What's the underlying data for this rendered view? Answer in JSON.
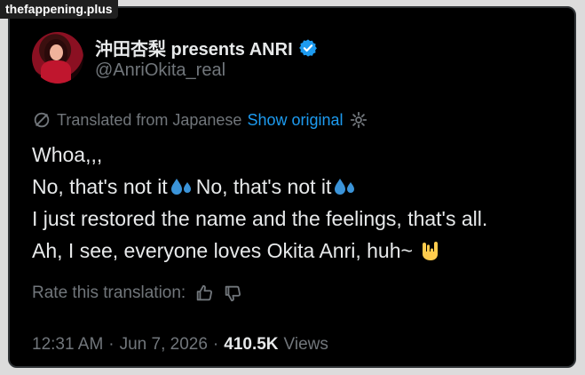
{
  "watermark": "thefappening.plus",
  "author": {
    "display_name": "沖田杏梨 presents ANRI",
    "handle": "@AnriOkita_real",
    "verified_color": "#1d9bf0"
  },
  "translation": {
    "label": "Translated from Japanese",
    "show_original": "Show original",
    "icons": [
      "translate-icon",
      "gear-icon"
    ]
  },
  "tweet": {
    "line1": "Whoa,,,",
    "line2_a": "No, that's not it",
    "line2_b": " No, that's not it",
    "line3": "I just restored the name and the feelings, that's all.",
    "line4": "Ah, I see, everyone loves Okita Anri, huh~",
    "emojis": [
      "sweat-droplets-emoji",
      "sign-of-horns-emoji"
    ]
  },
  "rating": {
    "label": "Rate this translation:",
    "icons": [
      "thumbs-up-icon",
      "thumbs-down-icon"
    ]
  },
  "meta": {
    "time": "12:31 AM",
    "sep1": "·",
    "date": "Jun 7, 2026",
    "sep2": "·",
    "views_count": "410.5K",
    "views_label": "Views"
  },
  "colors": {
    "background": "#000000",
    "text": "#e7e9ea",
    "muted": "#71767b",
    "link": "#1d9bf0"
  }
}
